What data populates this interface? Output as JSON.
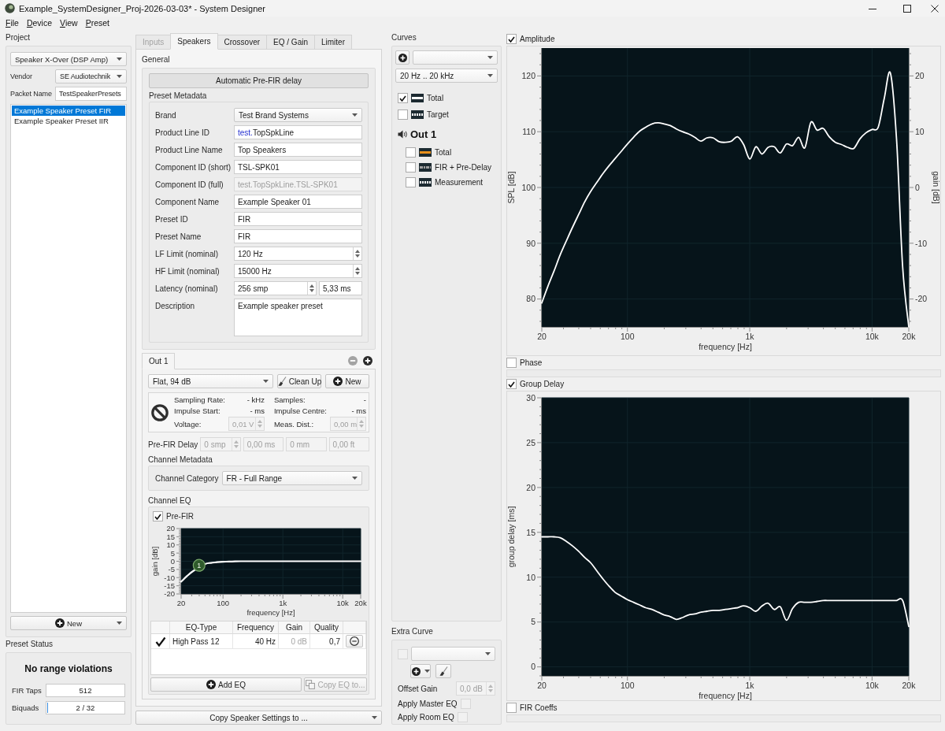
{
  "window": {
    "title": "Example_SystemDesigner_Proj-2026-03-03* - System Designer"
  },
  "menu": [
    "File",
    "Device",
    "View",
    "Preset"
  ],
  "project": {
    "title": "Project",
    "system": "Speaker X-Over (DSP Amp)",
    "vendor_label": "Vendor",
    "vendor": "SE Audiotechnik",
    "packet_label": "Packet Name",
    "packet": "TestSpeakerPresets",
    "presets": [
      {
        "label": "Example Speaker Preset FIR",
        "selected": true
      },
      {
        "label": "Example Speaker Preset IIR",
        "selected": false
      }
    ],
    "new_button": "New"
  },
  "preset_status": {
    "title": "Preset Status",
    "message": "No range violations",
    "meters": [
      {
        "label": "FIR Taps",
        "kind": "field",
        "text": "512"
      },
      {
        "label": "Biquads",
        "kind": "meter",
        "text": "2 / 32",
        "level": 0.03
      }
    ]
  },
  "tabs": [
    {
      "label": "Inputs",
      "selected": false,
      "disabled": true
    },
    {
      "label": "Speakers",
      "selected": true,
      "disabled": false
    },
    {
      "label": "Crossover",
      "selected": false,
      "disabled": false
    },
    {
      "label": "EQ / Gain",
      "selected": false,
      "disabled": false
    },
    {
      "label": "Limiter",
      "selected": false,
      "disabled": false
    }
  ],
  "general": {
    "title": "General",
    "auto_delay_button": "Automatic Pre-FIR delay",
    "metadata_title": "Preset Metadata",
    "fields": [
      {
        "label": "Brand",
        "kind": "combo",
        "value": "Test Brand Systems",
        "disabled": false
      },
      {
        "label": "Product Line ID",
        "kind": "text",
        "prefix": "test.",
        "value": "TopSpkLine",
        "disabled": false
      },
      {
        "label": "Product Line Name",
        "kind": "text",
        "value": "Top Speakers",
        "disabled": false
      },
      {
        "label": "Component ID (short)",
        "kind": "text",
        "value": "TSL-SPK01",
        "disabled": false
      },
      {
        "label": "Component ID (full)",
        "kind": "text",
        "value": "test.TopSpkLine.TSL-SPK01",
        "disabled": true
      },
      {
        "label": "Component Name",
        "kind": "text",
        "value": "Example Speaker 01",
        "disabled": false
      },
      {
        "label": "Preset ID",
        "kind": "text",
        "value": "FIR",
        "disabled": false
      },
      {
        "label": "Preset Name",
        "kind": "text",
        "value": "FIR",
        "disabled": false
      },
      {
        "label": "LF Limit (nominal)",
        "kind": "spin",
        "value": "120 Hz",
        "disabled": false
      },
      {
        "label": "HF Limit (nominal)",
        "kind": "spin",
        "value": "15000 Hz",
        "disabled": false
      },
      {
        "label": "Latency (nominal)",
        "kind": "spin_pair",
        "value": "256 smp",
        "value2": "5,33 ms",
        "disabled": false
      },
      {
        "label": "Description",
        "kind": "textarea",
        "value": "Example speaker preset",
        "disabled": false
      }
    ]
  },
  "output": {
    "tabs": [
      {
        "label": "Out 1",
        "selected": true
      }
    ],
    "tab_actions": [
      {
        "kind": "remove",
        "disabled": true
      },
      {
        "kind": "add",
        "disabled": false
      }
    ],
    "measurement": "Flat, 94 dB",
    "cleanup_button": "Clean Up",
    "new_button": "New",
    "info": [
      {
        "label": "Sampling Rate:",
        "kind": "text",
        "value": "- kHz",
        "disabled": false
      },
      {
        "label": "Samples:",
        "kind": "text",
        "value": "-",
        "disabled": false
      },
      {
        "label": "Impulse Start:",
        "kind": "text",
        "value": "- ms",
        "disabled": false
      },
      {
        "label": "Impulse Centre:",
        "kind": "text",
        "value": "- ms",
        "disabled": false
      },
      {
        "label": "Voltage:",
        "kind": "spin",
        "value": "0,01 V",
        "disabled": true
      },
      {
        "label": "Meas. Dist.:",
        "kind": "spin",
        "value": "0,00 m",
        "disabled": true
      }
    ],
    "pre_fir_delay": {
      "label": "Pre-FIR Delay",
      "disabled": true,
      "fields": [
        {
          "kind": "spin",
          "value": "0 smp"
        },
        {
          "kind": "text",
          "value": "0,00 ms"
        },
        {
          "kind": "text",
          "value": "0 mm"
        },
        {
          "kind": "text",
          "value": "0,00 ft"
        }
      ]
    },
    "channel_metadata": {
      "title": "Channel Metadata",
      "category_label": "Channel Category",
      "category": "FR - Full Range"
    },
    "channel_eq": {
      "title": "Channel EQ",
      "pre_fir": {
        "label": "Pre-FIR",
        "checked": true
      },
      "log_x": true,
      "chart_data": {
        "type": "line",
        "xlabel": "frequency [Hz]",
        "ylabel": "gain [dB]",
        "grid": true,
        "categories": [
          "20",
          null,
          null,
          null,
          null,
          null,
          null,
          "100",
          null,
          null,
          null,
          null,
          null,
          null,
          null,
          null,
          null,
          "1k",
          null,
          null,
          null,
          null,
          null,
          null,
          null,
          null,
          null,
          "10k",
          null,
          null,
          "20k"
        ],
        "series": [
          {
            "color": "#ffffff",
            "values": [
              -12.5,
              -9,
              -6,
              null,
              -1.7,
              -1,
              -0.6,
              -0.3,
              -0.2,
              -0.1,
              0,
              0,
              0,
              0,
              0,
              0,
              0,
              0,
              0,
              0,
              0,
              0,
              0,
              0,
              0,
              0,
              0,
              0,
              0,
              0,
              0
            ]
          }
        ],
        "ylim": [
          -20,
          20
        ],
        "yticks": [
          -20,
          -15,
          -10,
          -5,
          0,
          5,
          10,
          15,
          20
        ],
        "annotations": [
          {
            "text": "1",
            "y": -2.5
          }
        ]
      },
      "table": {
        "columns": [
          "EQ-Type",
          "Frequency",
          "Gain",
          "Quality"
        ],
        "rows": [
          {
            "enabled": true,
            "type": "High Pass 12",
            "frequency": "40 Hz",
            "gain": "0 dB",
            "gain_disabled": true,
            "quality": "0,7"
          }
        ]
      },
      "add_button": "Add EQ",
      "copy_button": {
        "label": "Copy EQ to...",
        "disabled": true
      }
    }
  },
  "copy_settings_button": "Copy Speaker Settings to ...",
  "curves": {
    "title": "Curves",
    "range": "20 Hz .. 20 kHz",
    "tree": [
      {
        "kind": "solid",
        "label": "Total",
        "checked": true,
        "color": "#ffffff"
      },
      {
        "kind": "dotted",
        "label": "Target",
        "checked": false,
        "color": "#ffffff"
      },
      {
        "kind": "group",
        "label": "Out 1",
        "children": [
          {
            "kind": "solid",
            "label": "Total",
            "checked": false,
            "color": "#e8901c"
          },
          {
            "kind": "dashdot",
            "label": "FIR + Pre-Delay",
            "checked": false,
            "color": "#a0a0a0"
          },
          {
            "kind": "dotted",
            "label": "Measurement",
            "checked": false,
            "color": "#ffffff"
          }
        ]
      }
    ]
  },
  "extra_curve": {
    "title": "Extra Curve",
    "checked": false,
    "disabled": true,
    "offset_label": "Offset Gain",
    "offset": "0,0 dB",
    "options": [
      {
        "label": "Apply Master EQ",
        "checked": false
      },
      {
        "label": "Apply Room EQ",
        "checked": false
      }
    ]
  },
  "plots": [
    {
      "label": "Amplitude",
      "checked": true,
      "log_x": true,
      "chart_data": {
        "type": "line",
        "xlabel": "frequency [Hz]",
        "ylabel": "SPL [dB]",
        "grid": true,
        "categories": [
          "20",
          null,
          null,
          null,
          null,
          null,
          null,
          null,
          null,
          null,
          null,
          null,
          null,
          null,
          "100",
          null,
          null,
          null,
          null,
          null,
          null,
          null,
          null,
          null,
          null,
          null,
          null,
          null,
          null,
          null,
          null,
          null,
          null,
          null,
          "1k",
          null,
          null,
          null,
          null,
          null,
          null,
          null,
          null,
          null,
          null,
          null,
          null,
          null,
          null,
          null,
          null,
          null,
          null,
          null,
          "10k",
          null,
          null,
          null,
          null,
          null,
          "20k"
        ],
        "series": [
          {
            "color": "#ffffff",
            "values": [
              79.3,
              82.3,
              85.0,
              87.9,
              90.4,
              92.8,
              95.1,
              97.4,
              99.3,
              100.9,
              102.5,
              103.9,
              105.2,
              106.5,
              107.8,
              109.0,
              110.1,
              110.8,
              111.4,
              111.6,
              111.4,
              111.1,
              110.5,
              110.0,
              109.6,
              109.0,
              108.3,
              108.9,
              108.9,
              108.2,
              108.1,
              108.3,
              109.1,
              107.7,
              105.1,
              107.3,
              106.0,
              107.2,
              107.3,
              106.2,
              107.8,
              107.5,
              109.0,
              107.1,
              111.7,
              110.3,
              110.6,
              109.1,
              108.1,
              107.7,
              107.2,
              107.0,
              108.7,
              109.8,
              110.4,
              110.8,
              116.0,
              120.5,
              108.6,
              85.8,
              75.0
            ]
          }
        ],
        "ylim": [
          75,
          125
        ],
        "yticks": [
          80,
          90,
          100,
          110,
          120
        ],
        "y2label": "gain [dB]",
        "y2lim": [
          -25,
          25
        ],
        "y2ticks": [
          -20,
          -10,
          0,
          10,
          20
        ]
      }
    },
    {
      "label": "Phase",
      "checked": false
    },
    {
      "label": "Group Delay",
      "checked": true,
      "log_x": true,
      "chart_data": {
        "type": "line",
        "xlabel": "frequency [Hz]",
        "ylabel": "group delay [ms]",
        "grid": true,
        "categories": [
          "20",
          null,
          null,
          null,
          null,
          null,
          null,
          null,
          null,
          null,
          null,
          null,
          null,
          null,
          "100",
          null,
          null,
          null,
          null,
          null,
          null,
          null,
          null,
          null,
          null,
          null,
          null,
          null,
          null,
          null,
          null,
          null,
          null,
          null,
          "1k",
          null,
          null,
          null,
          null,
          null,
          null,
          null,
          null,
          null,
          null,
          null,
          null,
          null,
          null,
          null,
          null,
          null,
          null,
          null,
          "10k",
          null,
          null,
          null,
          null,
          null,
          "20k"
        ],
        "series": [
          {
            "color": "#ffffff",
            "values": [
              14.5,
              14.5,
              14.5,
              14.4,
              14.0,
              13.5,
              12.9,
              12.2,
              11.6,
              10.7,
              9.8,
              9.0,
              8.3,
              7.9,
              7.5,
              7.2,
              6.9,
              6.6,
              6.4,
              6.1,
              5.8,
              5.6,
              5.3,
              5.5,
              5.8,
              5.9,
              6.1,
              6.2,
              6.3,
              6.3,
              6.4,
              6.5,
              6.6,
              6.8,
              6.6,
              6.2,
              6.8,
              7.1,
              6.4,
              6.7,
              5.2,
              6.5,
              7.2,
              7.2,
              7.2,
              7.3,
              7.4,
              7.4,
              7.4,
              7.4,
              7.4,
              7.4,
              7.4,
              7.4,
              7.4,
              7.4,
              7.4,
              7.4,
              7.4,
              7.4,
              4.5
            ]
          }
        ],
        "ylim": [
          -1,
          30
        ],
        "yticks": [
          0,
          5,
          10,
          15,
          20,
          25,
          30
        ]
      }
    },
    {
      "label": "FIR Coeffs",
      "checked": false
    }
  ]
}
